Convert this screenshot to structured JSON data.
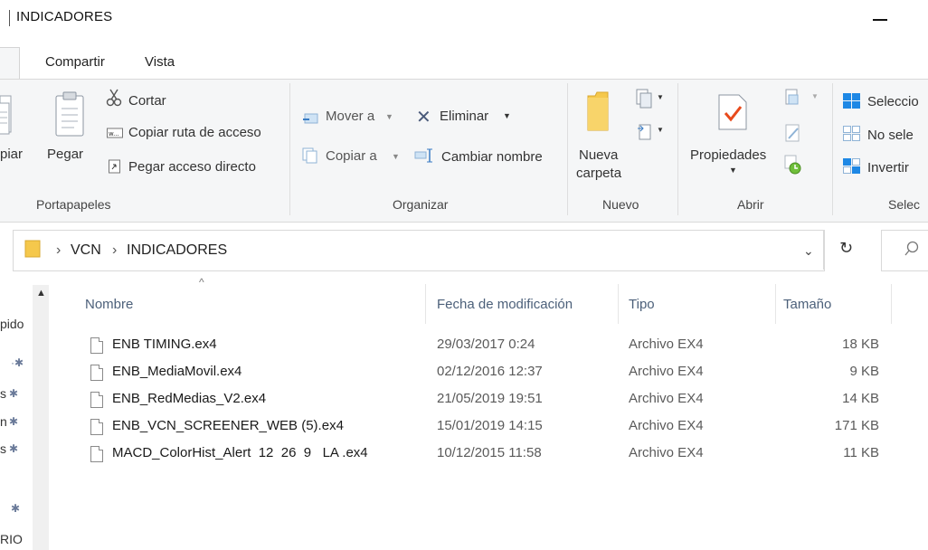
{
  "window": {
    "title": "INDICADORES"
  },
  "tabs": [
    "Compartir",
    "Vista"
  ],
  "ribbon": {
    "portapapeles": {
      "copiar": "piar",
      "pegar": "Pegar",
      "cortar": "Cortar",
      "copiar_ruta": "Copiar ruta de acceso",
      "pegar_acceso": "Pegar acceso directo",
      "label": "Portapapeles"
    },
    "organizar": {
      "mover": "Mover a",
      "copiar_a": "Copiar a",
      "eliminar": "Eliminar",
      "cambiar_nombre": "Cambiar nombre",
      "label": "Organizar"
    },
    "nuevo": {
      "nueva_line1": "Nueva",
      "nueva_line2": "carpeta",
      "label": "Nuevo"
    },
    "abrir": {
      "propiedades": "Propiedades",
      "label": "Abrir"
    },
    "seleccionar": {
      "sel_todo": "Seleccio",
      "no_sel": "No sele",
      "invertir": "Invertir",
      "label": "Selec"
    }
  },
  "address": {
    "crumb1": "VCN",
    "crumb2": "INDICADORES",
    "separator": "›"
  },
  "nav": {
    "items": [
      "pido",
      "",
      "s",
      "n",
      "s",
      "",
      "RIO"
    ]
  },
  "columns": {
    "nombre": "Nombre",
    "fecha": "Fecha de modificación",
    "tipo": "Tipo",
    "tamano": "Tamaño"
  },
  "files": [
    {
      "name": "ENB TIMING.ex4",
      "date": "29/03/2017 0:24",
      "type": "Archivo EX4",
      "size": "18 KB"
    },
    {
      "name": "ENB_MediaMovil.ex4",
      "date": "02/12/2016 12:37",
      "type": "Archivo EX4",
      "size": "9 KB"
    },
    {
      "name": "ENB_RedMedias_V2.ex4",
      "date": "21/05/2019 19:51",
      "type": "Archivo EX4",
      "size": "14 KB"
    },
    {
      "name": "ENB_VCN_SCREENER_WEB (5).ex4",
      "date": "15/01/2019 14:15",
      "type": "Archivo EX4",
      "size": "171 KB"
    },
    {
      "name": "MACD_ColorHist_Alert  12  26  9   LA .ex4",
      "date": "10/12/2015 11:58",
      "type": "Archivo EX4",
      "size": "11 KB"
    }
  ],
  "colors": {
    "accent": "#1e88e5",
    "header_text": "#4c607a",
    "folder": "#f5c84c",
    "check": "#e84a1c"
  }
}
